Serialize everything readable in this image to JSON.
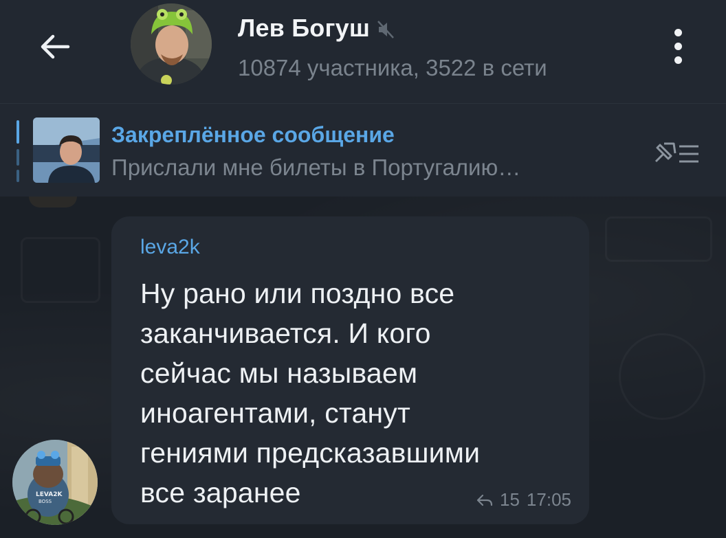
{
  "header": {
    "title": "Лев Богуш",
    "subtitle": "10874 участника, 3522 в сети",
    "back_icon": "arrow-left-icon",
    "mute_icon": "muted-speaker-icon",
    "menu_icon": "more-vertical-icon"
  },
  "pinned": {
    "title": "Закреплённое сообщение",
    "text": "Прислали мне билеты в Португалию…",
    "unpin_icon": "unpin-list-icon"
  },
  "message": {
    "sender": "leva2k",
    "text": "Ну рано или поздно все\nзаканчивается. И кого\nсейчас мы называем\nиноагентами, станут\nгениями предсказавшими\nвсе заранее",
    "reply_count": "15",
    "time": "17:05",
    "reply_icon": "reply-arrow-icon"
  },
  "colors": {
    "accent": "#5aa7e6",
    "header_bg": "#222831",
    "bubble_bg": "#242a33",
    "text_primary": "#eef1f4",
    "text_secondary": "#7c858f"
  }
}
